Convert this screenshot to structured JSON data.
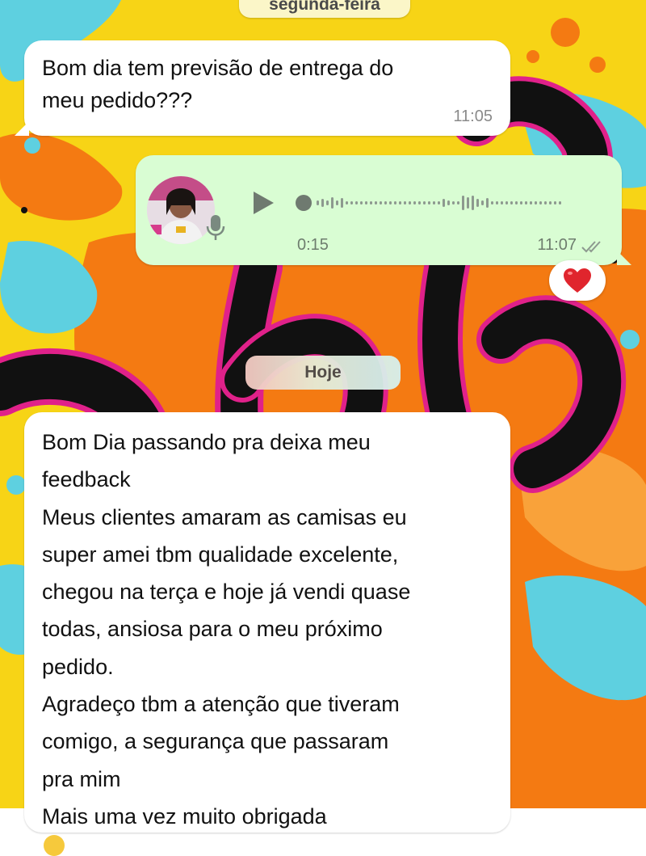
{
  "chat": {
    "date_chip_previous": "segunda-feira",
    "date_chip_today": "Hoje",
    "messages": [
      {
        "direction": "incoming",
        "lines": [
          "Bom dia tem previsão de entrega do",
          "meu pedido???"
        ],
        "time": "11:05"
      },
      {
        "direction": "outgoing",
        "type": "voice",
        "duration": "0:15",
        "time": "11:07",
        "status": "read",
        "reaction": "❤️"
      },
      {
        "direction": "incoming",
        "lines": [
          "Bom Dia passando pra deixa meu",
          "feedback",
          "Meus clientes amaram as camisas eu",
          "super amei tbm qualidade excelente,",
          "chegou na terça e hoje já vendi quase",
          "todas, ansiosa para o meu próximo",
          "pedido.",
          "Agradeço tbm a atenção que tiveram",
          "comigo, a segurança que passaram",
          "pra mim",
          "Mais uma vez muito obrigada"
        ]
      }
    ]
  },
  "colors": {
    "incoming_bubble": "#ffffff",
    "outgoing_bubble": "#d9fdd3",
    "wallpaper_yellow": "#f7d416",
    "wallpaper_orange": "#f47a12",
    "wallpaper_cyan": "#5ed0e0",
    "wallpaper_black": "#111111",
    "wallpaper_magenta": "#e0218a"
  },
  "icons": {
    "play": "play-icon",
    "mic": "mic-icon",
    "ticks": "double-check-icon",
    "reaction": "heart-icon"
  }
}
